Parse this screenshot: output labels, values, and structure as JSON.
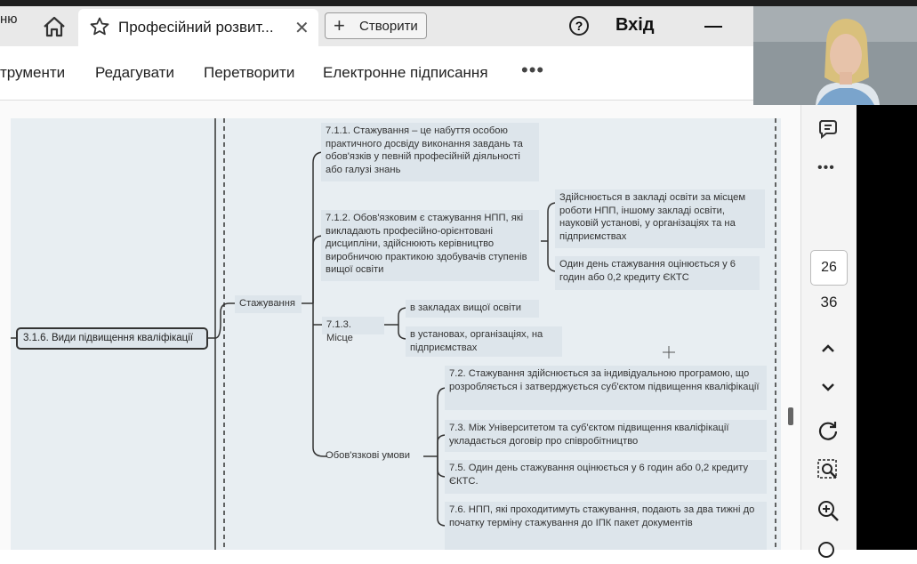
{
  "browser": {
    "prev_tab_partial": "ню",
    "active_tab_title": "Професійний розвит...",
    "create_button_label": "Створити",
    "login_label": "Вхід"
  },
  "toolbar": {
    "items": [
      "трументи",
      "Редагувати",
      "Перетворити",
      "Електронне підписання"
    ],
    "more": "•••"
  },
  "mindmap": {
    "root": "3.1.6. Види підвищення кваліфікації",
    "branch": "Стажування",
    "n711": "7.1.1. Стажування – це набуття особою практичного досвіду виконання завдань та обов'язків у певній професійній діяльності або галузі знань",
    "n712": "7.1.2. Обов'язковим є стажування НПП, які викладають професійно-орієнтовані дисципліни, здійснюють керівництво виробничою практикою здобувачів ступенів вищої освіти",
    "n712a": "Здійснюється в закладі освіти за місцем роботи НПП, іншому закладі освіти, науковій установі, у організаціях та на підприємствах",
    "n712b": "Один день стажування оцінюється у 6 годин або 0,2 кредиту ЄКТС",
    "n713": "7.1.3. Місце",
    "n713a": "в закладах вищої освіти",
    "n713b": "в установах, організаціях, на підприємствах",
    "mandatory": "Обов'язкові умови",
    "n72": "7.2. Стажування здійснюється за індивідуальною програмою, що розробляється і затверджується суб'єктом підвищення кваліфікації",
    "n73": "7.3. Між Університетом та суб'єктом підвищення кваліфікації укладається договір про співробітництво",
    "n75": "7.5. Один день стажування оцінюється у 6 годин або 0,2 кредиту ЄКТС.",
    "n76": "7.6. НПП, які проходитимуть стажування, подають за два тижні до початку терміну стажування до ІПК пакет документів"
  },
  "sidebar": {
    "current_page": "26",
    "total_pages": "36"
  },
  "colors": {
    "node_bg": "#dde5eb",
    "canvas_bg": "#e8eef2",
    "tab_bar": "#e9e9e9"
  }
}
